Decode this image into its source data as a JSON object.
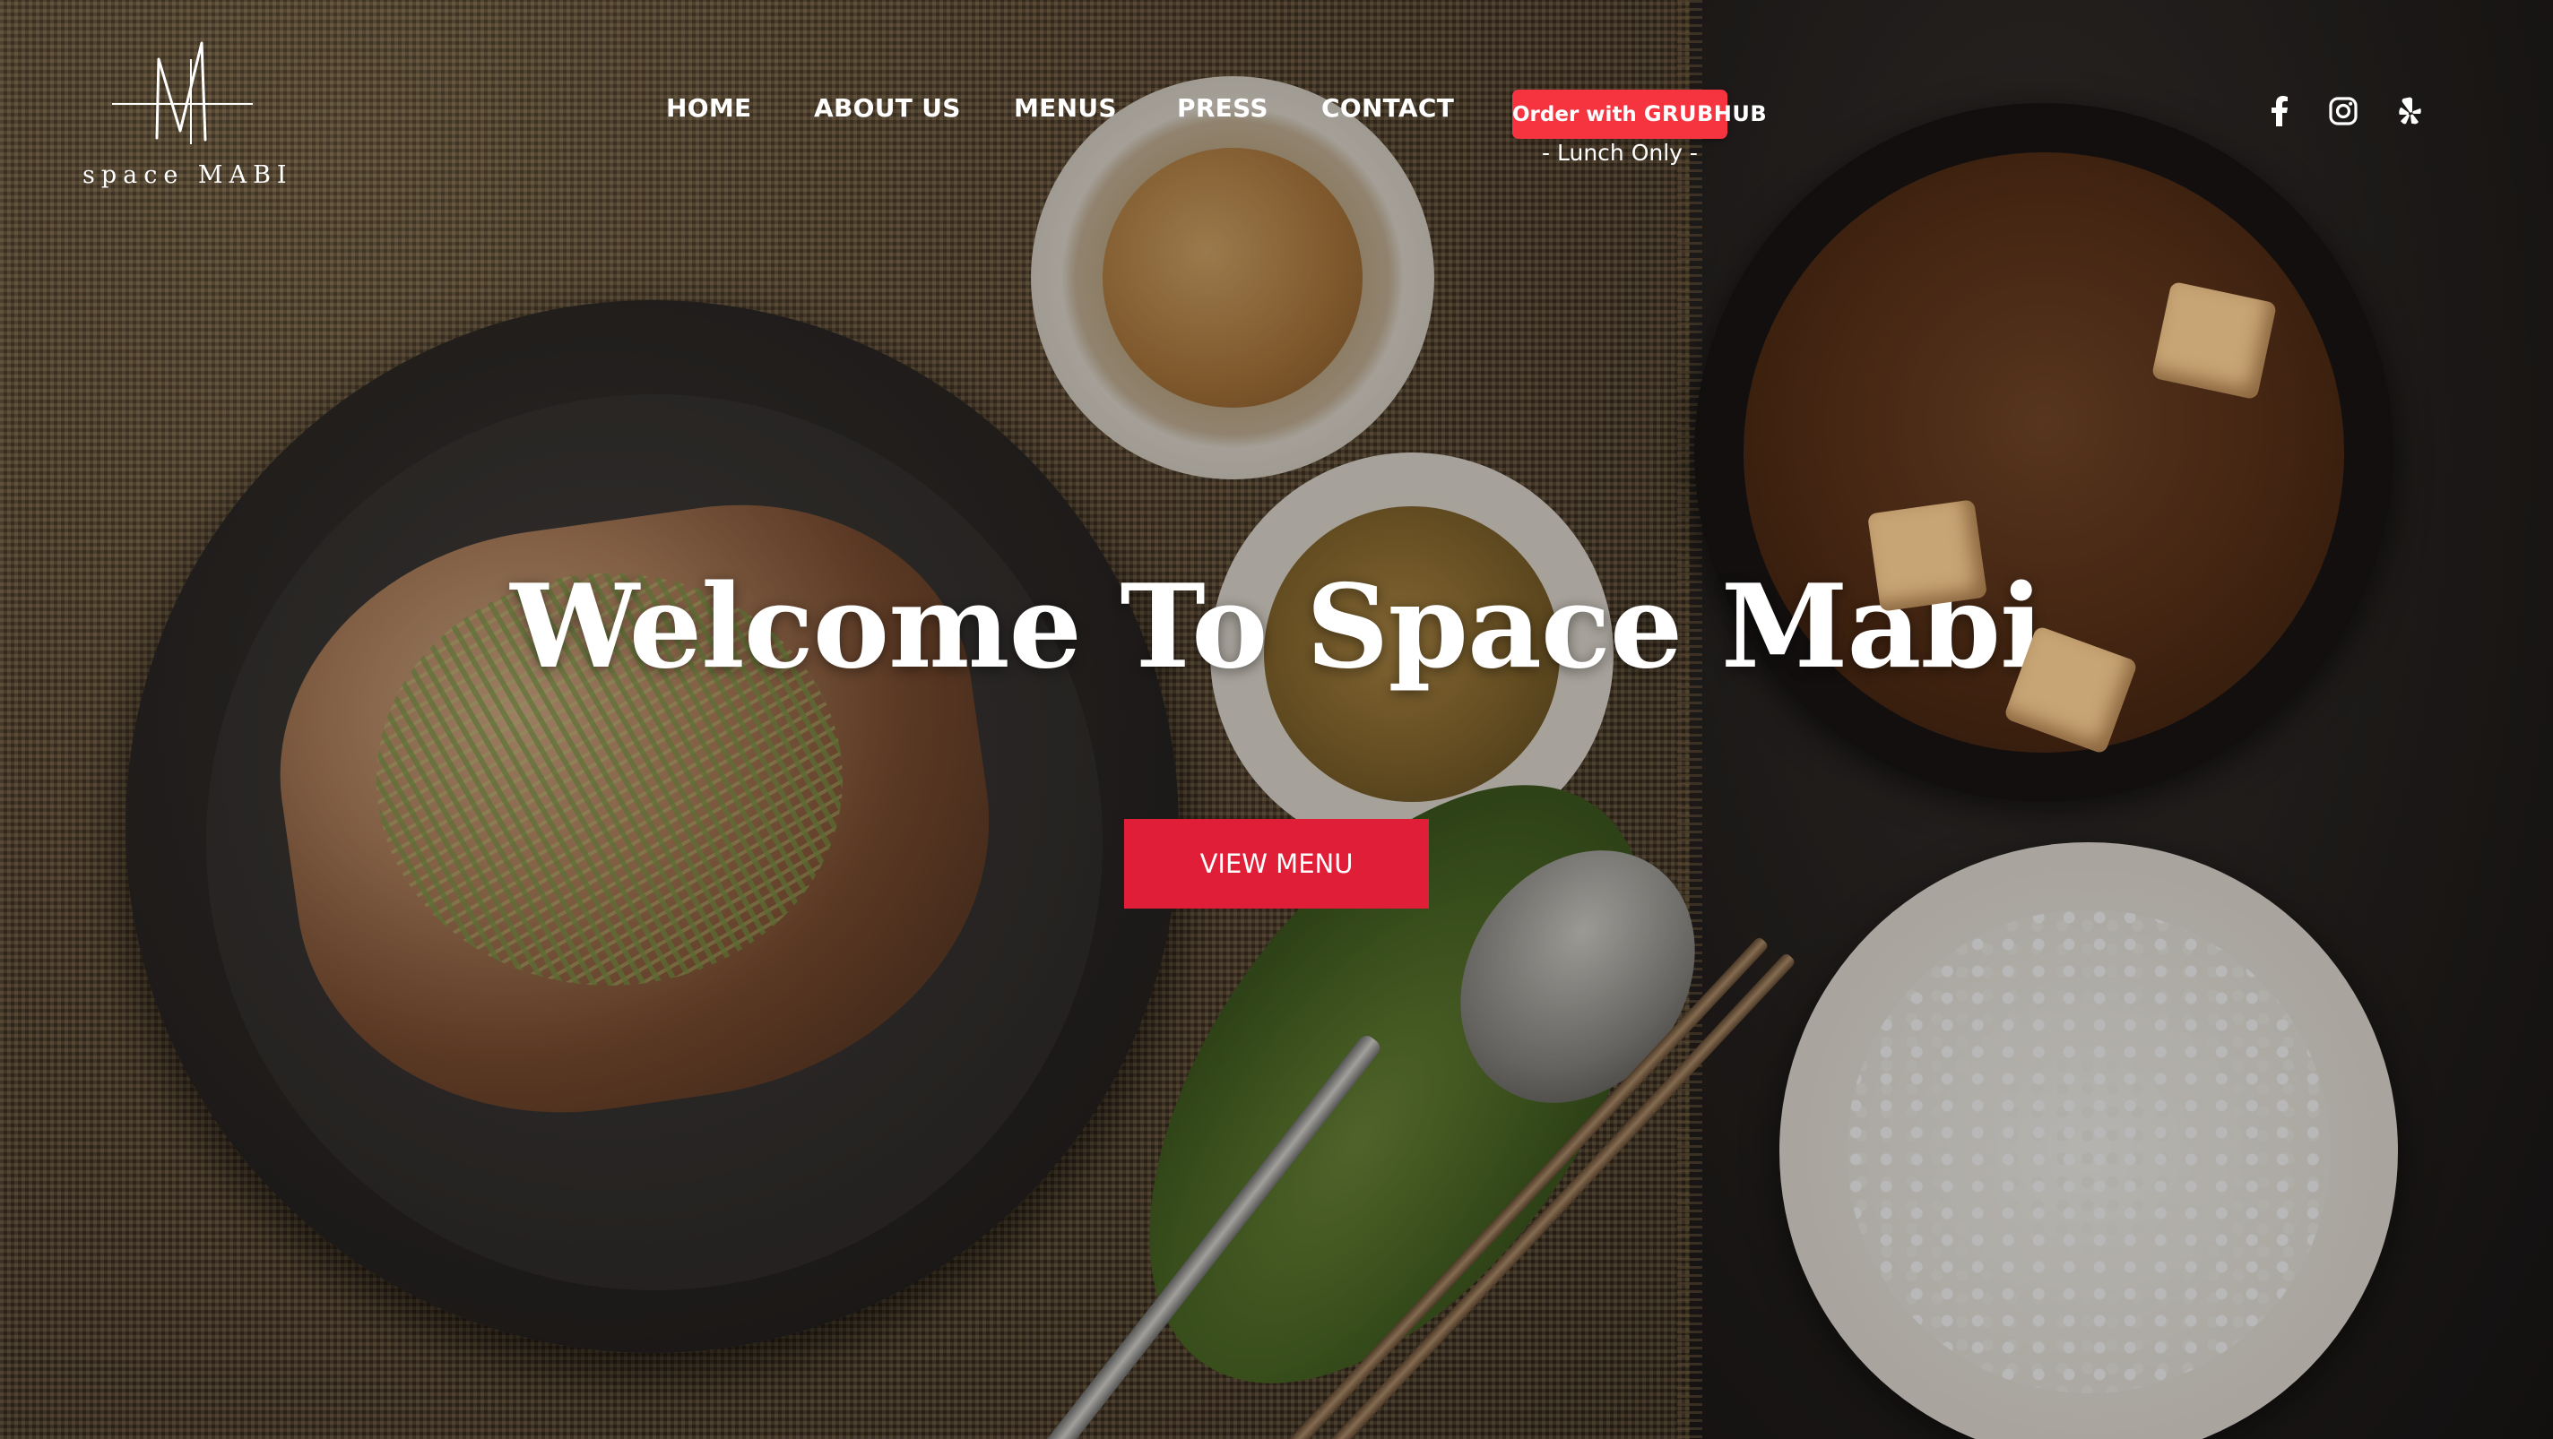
{
  "brand": {
    "logo_letter": "M",
    "logo_text": "space MABI"
  },
  "nav": {
    "items": [
      {
        "label": "HOME"
      },
      {
        "label": "ABOUT US"
      },
      {
        "label": "MENUS"
      },
      {
        "label": "PRESS"
      },
      {
        "label": "CONTACT"
      }
    ]
  },
  "order": {
    "prefix": "Order with",
    "brand": "GRUBHUB",
    "note": "- Lunch Only -",
    "color": "#f63440"
  },
  "social": [
    {
      "icon": "facebook-icon"
    },
    {
      "icon": "instagram-icon"
    },
    {
      "icon": "yelp-icon"
    }
  ],
  "hero": {
    "headline": "Welcome To Space Mabi",
    "cta_label": "VIEW MENU",
    "cta_color": "#e01e37"
  }
}
